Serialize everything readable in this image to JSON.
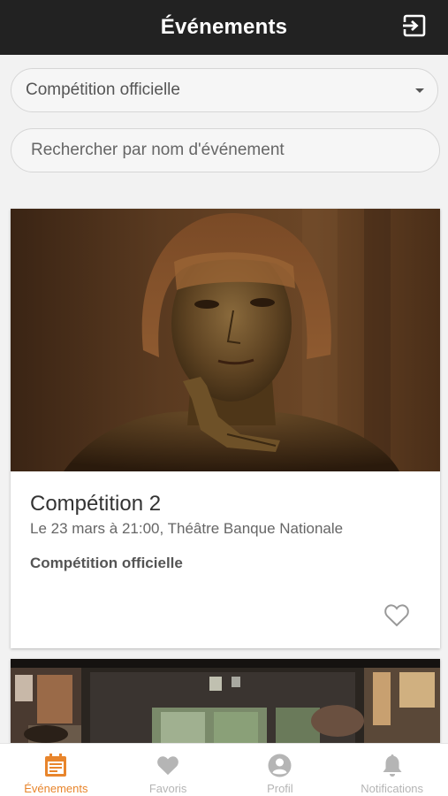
{
  "header": {
    "title": "Événements",
    "logout_icon": "logout-icon"
  },
  "filters": {
    "category_selected": "Compétition officielle",
    "search_placeholder": "Rechercher par nom d'événement"
  },
  "events": [
    {
      "title": "Compétition 2",
      "datetime_venue": "Le 23 mars à 21:00, Théâtre Banque Nationale",
      "category": "Compétition officielle",
      "favorite": false,
      "image": "portrait of a person with bob haircut and golden skin, finger at chin"
    },
    {
      "image": "interior of a shop with large windows"
    }
  ],
  "bottom_nav": {
    "items": [
      {
        "label": "Événements",
        "icon": "calendar-icon",
        "active": true
      },
      {
        "label": "Favoris",
        "icon": "heart-icon",
        "active": false
      },
      {
        "label": "Profil",
        "icon": "profile-icon",
        "active": false
      },
      {
        "label": "Notifications",
        "icon": "bell-icon",
        "active": false
      }
    ]
  },
  "colors": {
    "header_bg": "#222222",
    "accent": "#e8852c",
    "inactive": "#b5b5b5"
  }
}
